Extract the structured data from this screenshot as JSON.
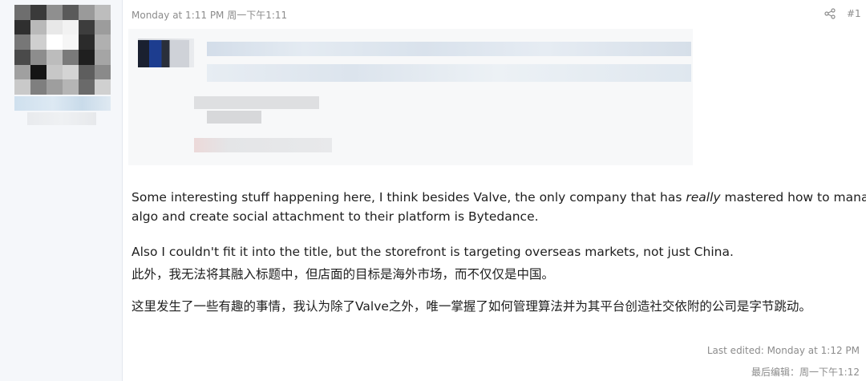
{
  "post": {
    "date": "Monday at 1:11 PM 周一下午1:11",
    "share_icon": "share-icon",
    "number": "#1"
  },
  "message": {
    "line1_before": "Some interesting stuff happening here, I think besides Valve, the only company that has ",
    "line1_emph": "really",
    "line1_after": " mastered how to manage an",
    "line2": "algo and create social attachment to their platform is Bytedance.",
    "line3": "Also I couldn't fit it into the title, but the storefront is targeting overseas markets, not just China.",
    "line4_cn": "此外，我无法将其融入标题中，但店面的目标是海外市场，而不仅仅是中国。",
    "line5_cn": "这里发生了一些有趣的事情，我认为除了Valve之外，唯一掌握了如何管理算法并为其平台创造社交依附的公司是字节跳动。"
  },
  "footer": {
    "last_edited": "Last edited: Monday at 1:12 PM",
    "last_edited_cn": "最后编辑：周一下午1:12"
  }
}
